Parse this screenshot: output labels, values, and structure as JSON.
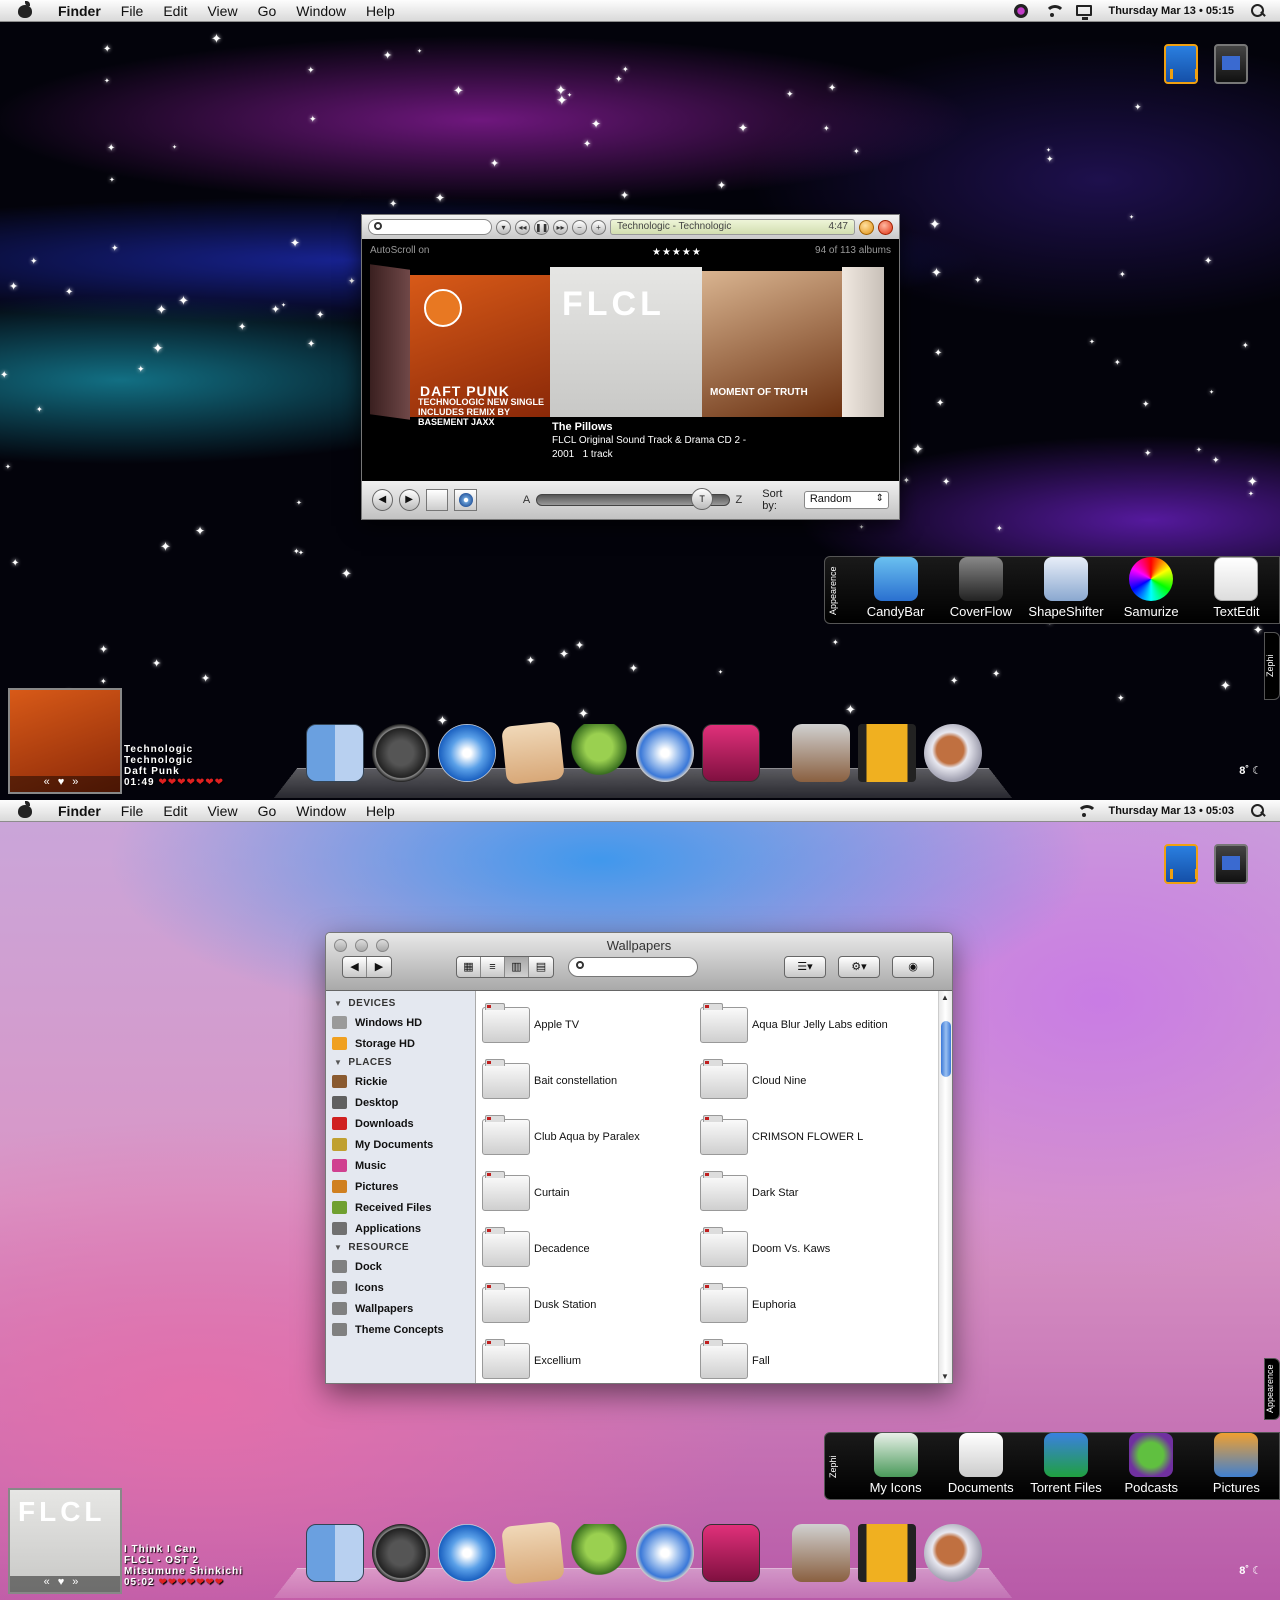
{
  "menubar": {
    "app_name": "Finder",
    "items": [
      "File",
      "Edit",
      "View",
      "Go",
      "Window",
      "Help"
    ]
  },
  "screen1": {
    "clock": "Thursday Mar 13 • 05:15",
    "coverflow": {
      "lcd_title": "Technologic - Technologic",
      "lcd_time": "4:47",
      "autoscroll": "AutoScroll on",
      "album_count": "94 of 113 albums",
      "rating": "★★★★★",
      "daft_title": "DAFT PUNK",
      "daft_sub1": "TECHNOLOGIC NEW SINGLE",
      "daft_sub2": "INCLUDES REMIX BY BASEMENT JAXX",
      "flcl_logo": "FLCL",
      "gang_text": "MOMENT OF TRUTH",
      "info_title": "The Pillows",
      "info_album": "FLCL Original Sound Track & Drama CD 2 -",
      "info_year": "2001",
      "info_tracks": "1 track",
      "slider_a": "A",
      "slider_z": "Z",
      "slider_knob": "T",
      "slider_position": 0.8,
      "sort_label": "Sort by:",
      "sort_value": "Random"
    },
    "shelf": {
      "tab": "Appearence",
      "items": [
        "CandyBar",
        "CoverFlow",
        "ShapeShifter",
        "Samurize",
        "TextEdit"
      ]
    },
    "side_tab": "Zephi",
    "now_playing": {
      "line1": "Technologic",
      "line2": "Technologic",
      "line3": "Daft Punk",
      "time": "01:49",
      "hearts": "❤❤❤❤❤❤❤",
      "controls": "«♥»"
    },
    "weather": "8˚ ☾"
  },
  "screen2": {
    "clock": "Thursday Mar 13 • 05:03",
    "finder": {
      "title": "Wallpapers",
      "sidebar": [
        {
          "type": "section",
          "label": "DEVICES"
        },
        {
          "type": "item",
          "label": "Windows HD",
          "color": "#9a9a9a"
        },
        {
          "type": "item",
          "label": "Storage HD",
          "color": "#f0a020"
        },
        {
          "type": "section",
          "label": "PLACES"
        },
        {
          "type": "item",
          "label": "Rickie",
          "color": "#8a5a30"
        },
        {
          "type": "item",
          "label": "Desktop",
          "color": "#606060"
        },
        {
          "type": "item",
          "label": "Downloads",
          "color": "#d02020"
        },
        {
          "type": "item",
          "label": "My Documents",
          "color": "#c0a030"
        },
        {
          "type": "item",
          "label": "Music",
          "color": "#d04090"
        },
        {
          "type": "item",
          "label": "Pictures",
          "color": "#d08020"
        },
        {
          "type": "item",
          "label": "Received Files",
          "color": "#70a030"
        },
        {
          "type": "item",
          "label": "Applications",
          "color": "#707070"
        },
        {
          "type": "section",
          "label": "RESOURCE"
        },
        {
          "type": "item",
          "label": "Dock",
          "color": "#808080"
        },
        {
          "type": "item",
          "label": "Icons",
          "color": "#808080"
        },
        {
          "type": "item",
          "label": "Wallpapers",
          "color": "#808080"
        },
        {
          "type": "item",
          "label": "Theme Concepts",
          "color": "#808080"
        }
      ],
      "folders": [
        "Apple TV",
        "Aqua Blur Jelly Labs edition",
        "Bait constellation",
        "Cloud Nine",
        "Club Aqua by Paralex",
        "CRIMSON FLOWER L",
        "Curtain",
        "Dark Star",
        "Decadence",
        "Doom Vs. Kaws",
        "Dusk Station",
        "Euphoria",
        "Excellium",
        "Fall"
      ]
    },
    "shelf": {
      "tab": "Zephi",
      "items": [
        "My Icons",
        "Documents",
        "Torrent Files",
        "Podcasts",
        "Pictures"
      ]
    },
    "side_tab": "Appearence",
    "now_playing": {
      "line1": "I Think I Can",
      "line2": "FLCL - OST 2",
      "line3": "Mitsumune Shinkichi",
      "time": "05:02",
      "hearts": "❤❤❤❤❤❤❤",
      "controls": "«♥»"
    },
    "weather": "8˚ ☾"
  }
}
